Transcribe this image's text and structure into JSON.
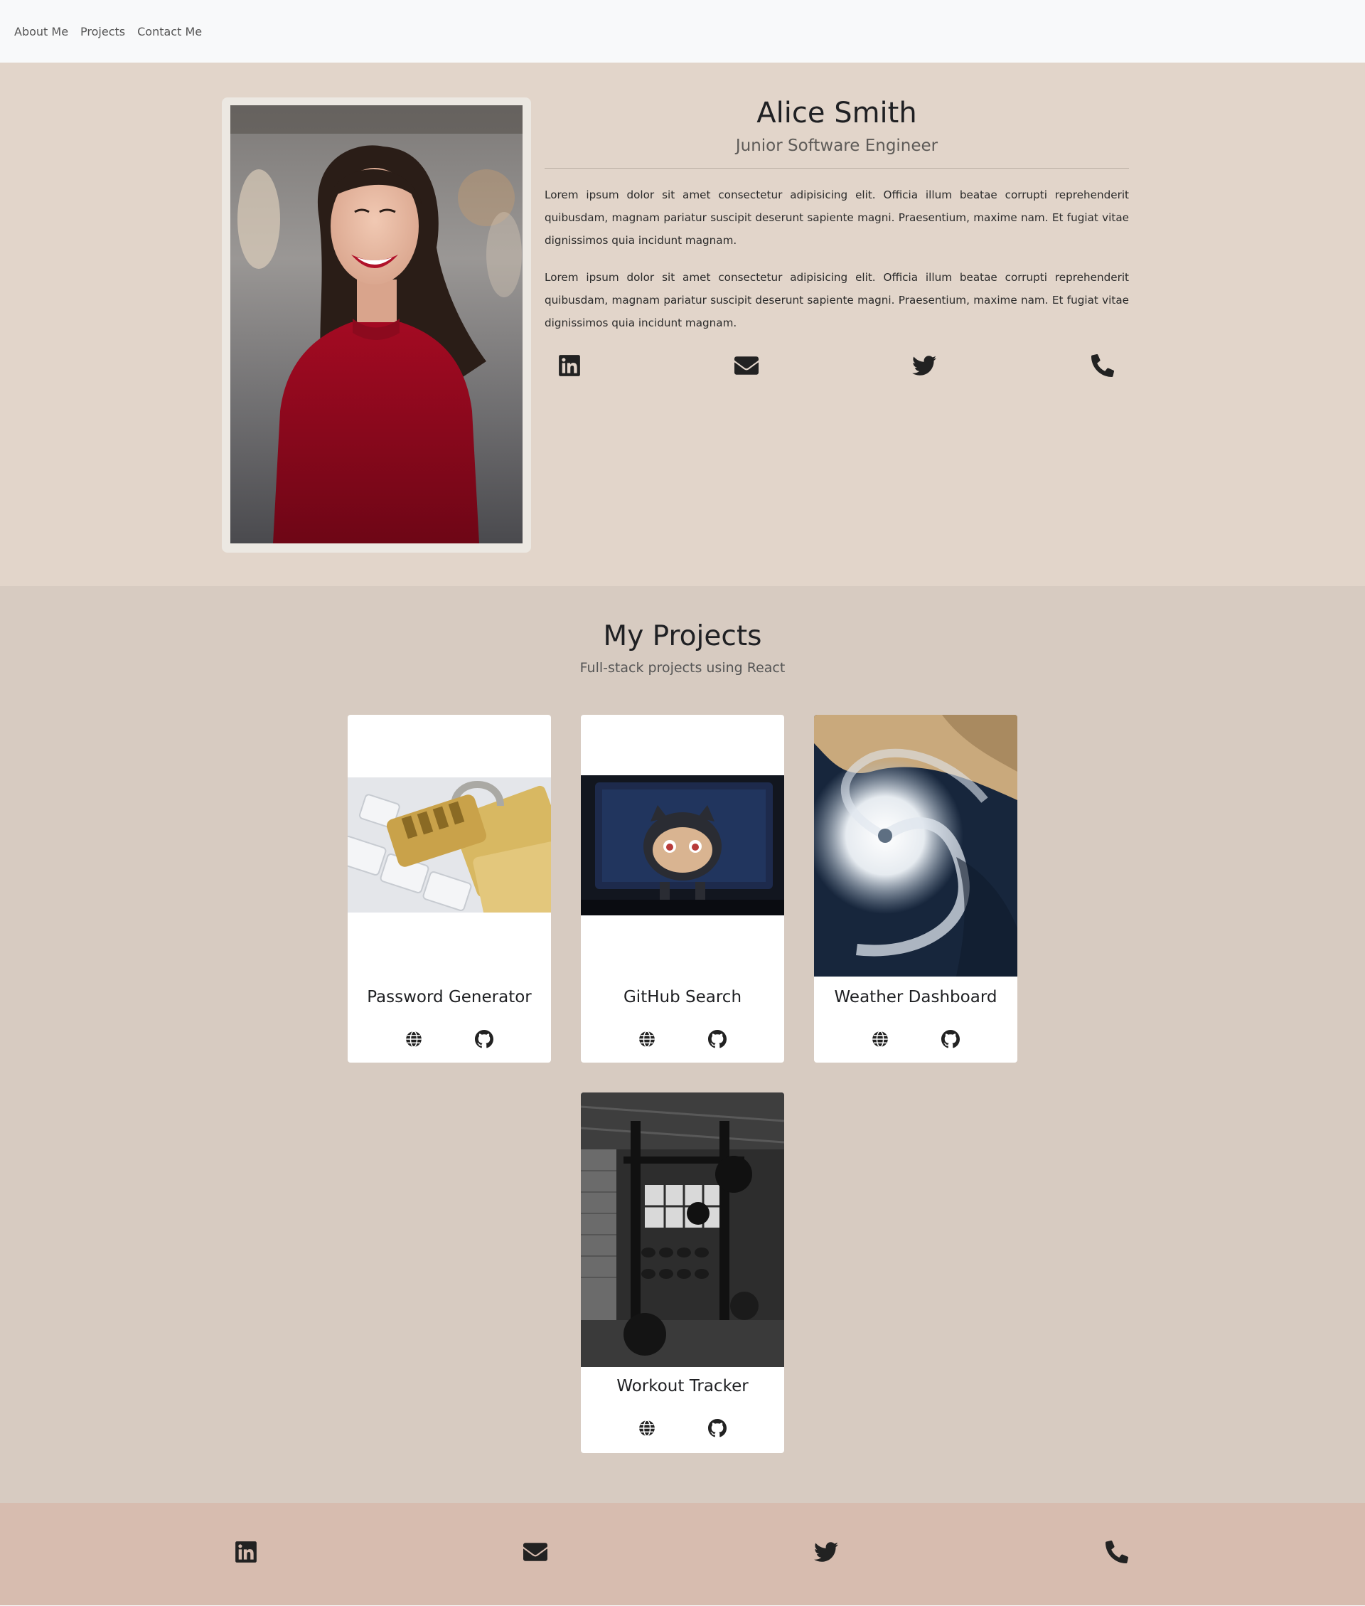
{
  "nav": {
    "items": [
      {
        "label": "About Me"
      },
      {
        "label": "Projects"
      },
      {
        "label": "Contact Me"
      }
    ]
  },
  "profile": {
    "name": "Alice Smith",
    "title": "Junior Software Engineer",
    "bio": [
      "Lorem ipsum dolor sit amet consectetur adipisicing elit. Officia illum beatae corrupti reprehenderit quibusdam, magnam pariatur suscipit deserunt sapiente magni. Praesentium, maxime nam. Et fugiat vitae dignissimos quia incidunt magnam.",
      "Lorem ipsum dolor sit amet consectetur adipisicing elit. Officia illum beatae corrupti reprehenderit quibusdam, magnam pariatur suscipit deserunt sapiente magni. Praesentium, maxime nam. Et fugiat vitae dignissimos quia incidunt magnam."
    ],
    "social_icons": [
      "linkedin-icon",
      "envelope-icon",
      "twitter-icon",
      "phone-icon"
    ]
  },
  "projects": {
    "heading": "My Projects",
    "subheading": "Full-stack projects using React",
    "items": [
      {
        "title": "Password Generator",
        "link_icons": [
          "globe-icon",
          "github-icon"
        ]
      },
      {
        "title": "GitHub Search",
        "link_icons": [
          "globe-icon",
          "github-icon"
        ]
      },
      {
        "title": "Weather Dashboard",
        "link_icons": [
          "globe-icon",
          "github-icon"
        ]
      },
      {
        "title": "Workout Tracker",
        "link_icons": [
          "globe-icon",
          "github-icon"
        ]
      }
    ]
  },
  "footer": {
    "social_icons": [
      "linkedin-icon",
      "envelope-icon",
      "twitter-icon",
      "phone-icon"
    ]
  },
  "colors": {
    "nav_bg": "#f8f9fa",
    "about_bg": "#e2d5ca",
    "projects_bg": "#d7cbc1",
    "footer_bg": "#d7bcaf",
    "card_bg": "#ffffff"
  }
}
